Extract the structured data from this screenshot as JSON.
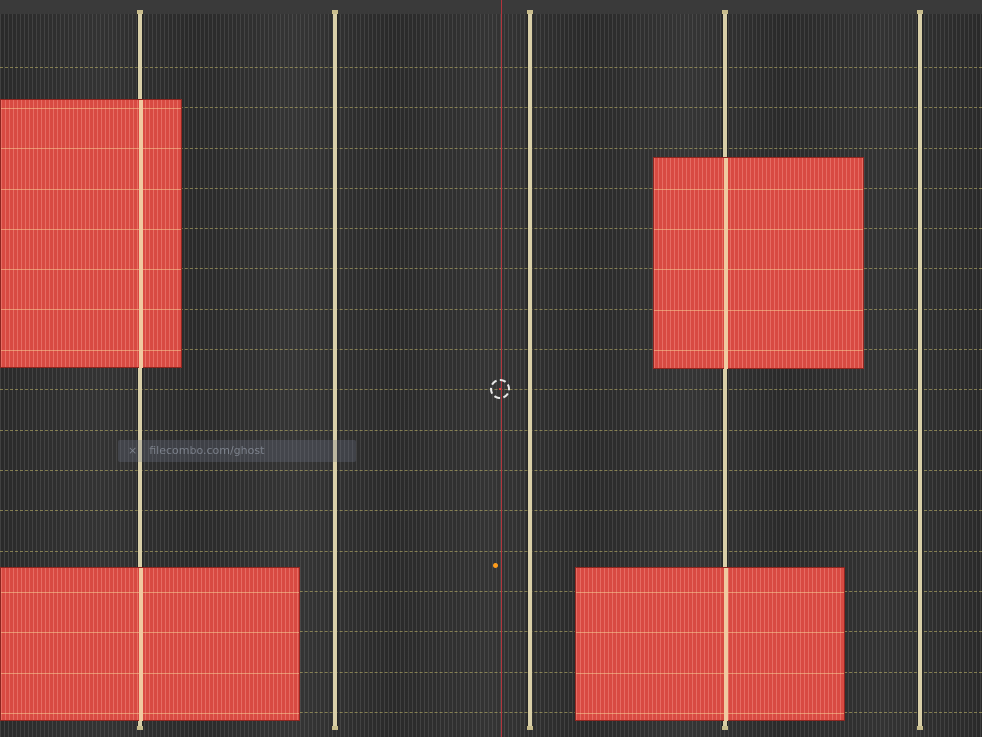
{
  "viewport": {
    "background": "#2b2b2b",
    "face_color": "#d84a42",
    "edge_color": "#d9cfa8",
    "axis_color": "#b3343c",
    "origin_color": "#ff9d1c"
  },
  "icons": {
    "cursor": "3d-cursor-icon",
    "origin": "object-origin-icon"
  },
  "watermark": {
    "mark": "×",
    "text": "filecombo.com/ghost"
  }
}
